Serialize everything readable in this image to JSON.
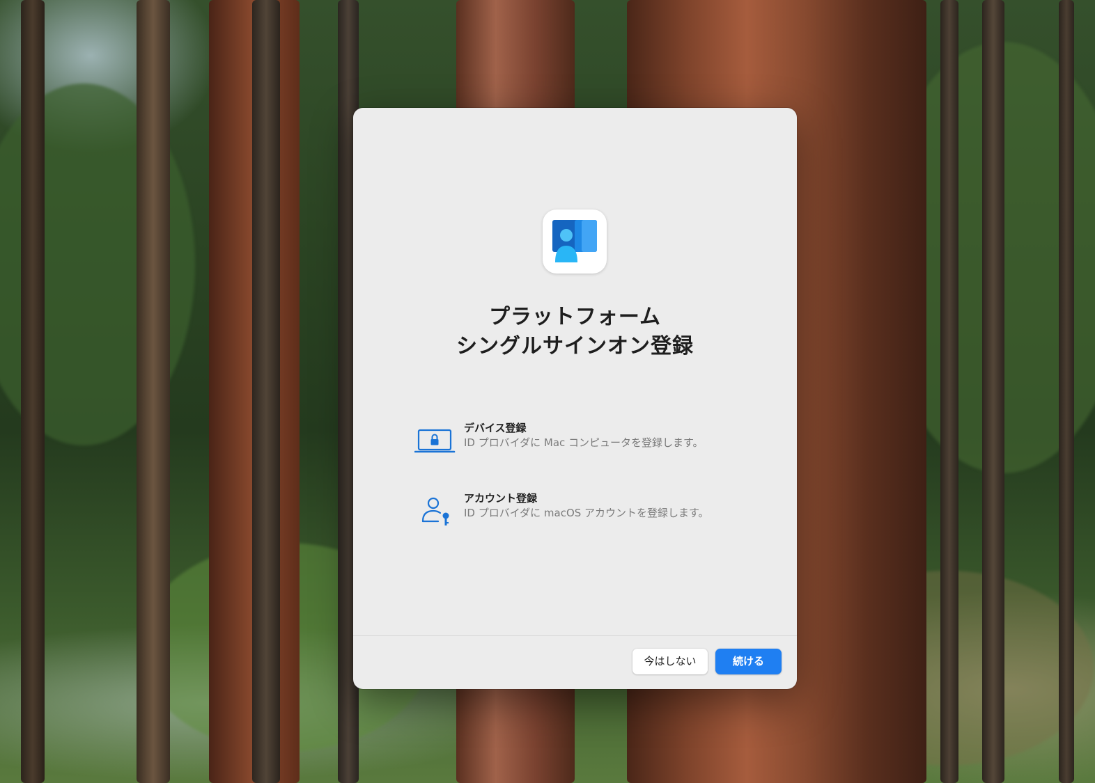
{
  "dialog": {
    "title_line1": "プラットフォーム",
    "title_line2": "シングルサインオン登録",
    "app_icon": "company-portal-icon",
    "features": [
      {
        "icon": "laptop-lock-icon",
        "title": "デバイス登録",
        "description": "ID プロバイダに Mac コンピュータを登録します。"
      },
      {
        "icon": "user-key-icon",
        "title": "アカウント登録",
        "description": "ID プロバイダに macOS アカウントを登録します。"
      }
    ],
    "buttons": {
      "not_now_label": "今はしない",
      "continue_label": "続ける"
    }
  },
  "colors": {
    "accent": "#1f7ff2",
    "dialog_background": "#ececec",
    "icon_blue": "#1a73d6"
  },
  "desktop": {
    "wallpaper": "redwood-forest"
  }
}
